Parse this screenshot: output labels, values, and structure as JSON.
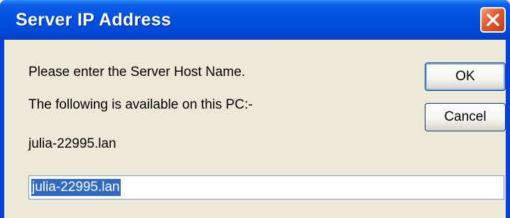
{
  "dialog": {
    "title": "Server IP Address",
    "prompt": "Please enter the Server Host Name.",
    "available_text": "The following is available on this PC:-",
    "host_name": "julia-22995.lan",
    "input_value": "julia-22995.lan"
  },
  "buttons": {
    "ok_label": "OK",
    "cancel_label": "Cancel"
  },
  "colors": {
    "titlebar": "#0151e0",
    "close_button": "#e05a30",
    "dialog_background": "#ece9d8",
    "selection": "#316ac5"
  },
  "icons": {
    "close": "close-icon"
  }
}
